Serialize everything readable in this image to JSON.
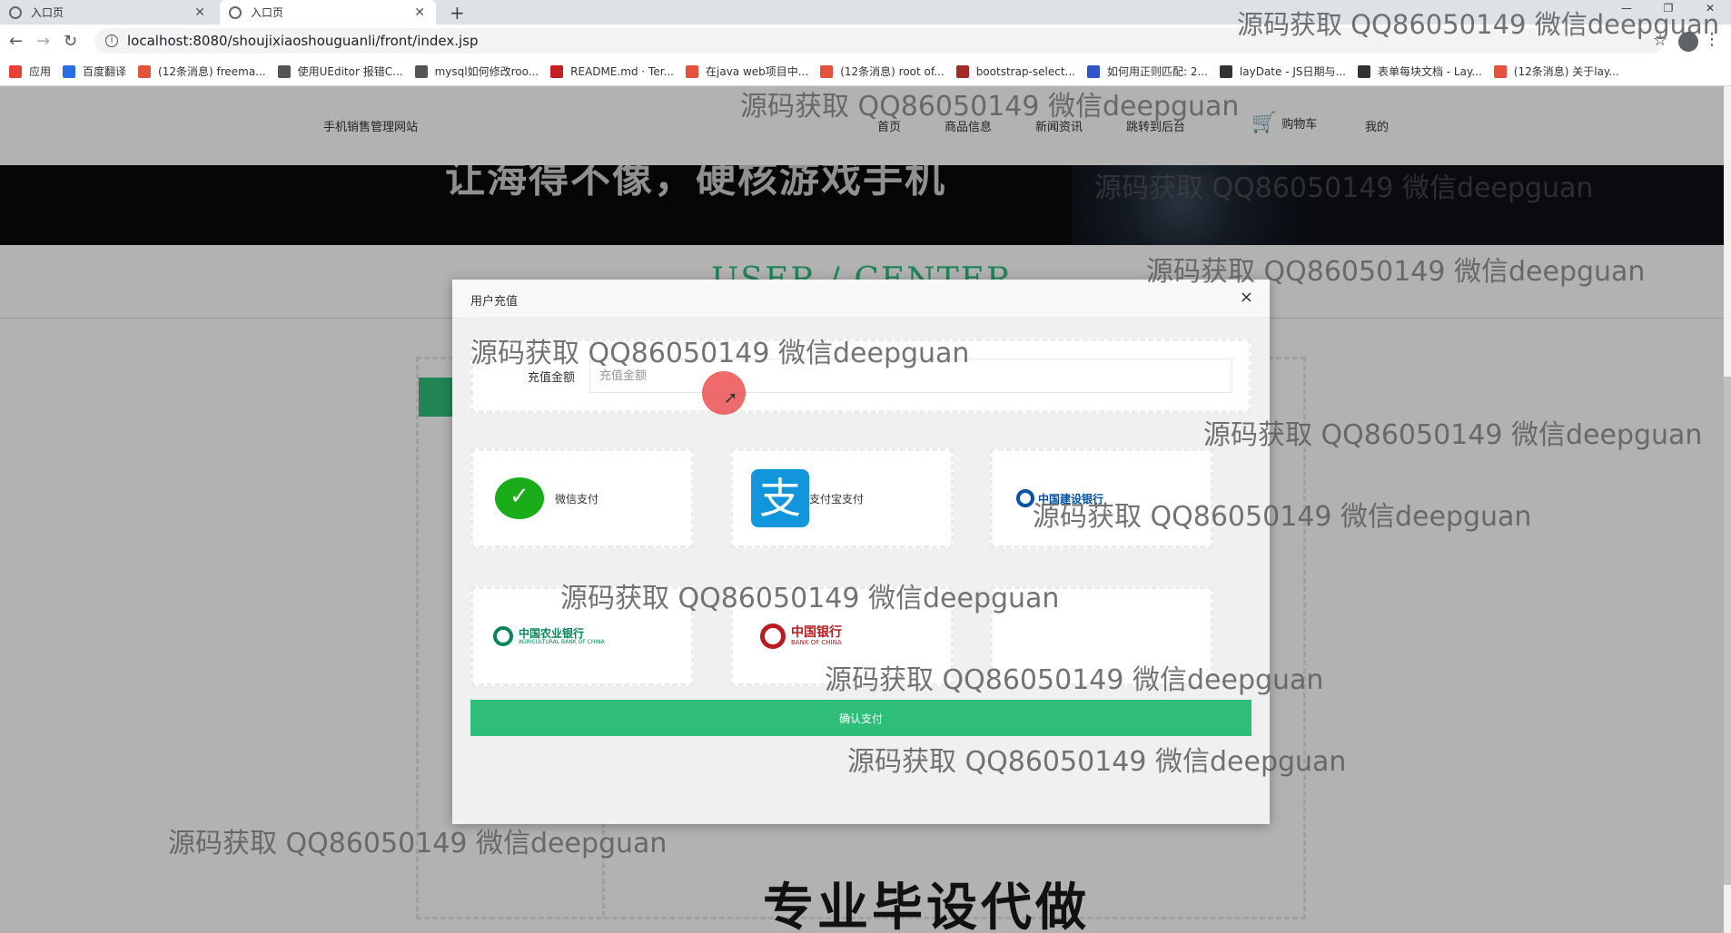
{
  "browser": {
    "tabs": [
      {
        "label": "入口页",
        "active": false
      },
      {
        "label": "入口页",
        "active": true
      }
    ],
    "new_tab": "+",
    "url": "localhost:8080/shoujixiaoshouguanli/front/index.jsp",
    "bookmarks": [
      {
        "label": "应用",
        "color": "#e94235"
      },
      {
        "label": "百度翻译",
        "color": "#2b6de5"
      },
      {
        "label": "(12条消息) freema...",
        "color": "#e4523d"
      },
      {
        "label": "使用UEditor 报错C...",
        "color": "#555555"
      },
      {
        "label": "mysql如何修改roo...",
        "color": "#555555"
      },
      {
        "label": "README.md · Ter...",
        "color": "#c71d23"
      },
      {
        "label": "在java web项目中...",
        "color": "#e4523d"
      },
      {
        "label": "(12条消息) root of...",
        "color": "#e4523d"
      },
      {
        "label": "bootstrap-select...",
        "color": "#a52a2a"
      },
      {
        "label": "如何用正则匹配: 2...",
        "color": "#3253c9"
      },
      {
        "label": "layDate - JS日期与...",
        "color": "#333333"
      },
      {
        "label": "表单每块文档 - Lay...",
        "color": "#333333"
      },
      {
        "label": "(12条消息) 关于lay...",
        "color": "#e4523d"
      }
    ]
  },
  "site": {
    "title": "手机销售管理网站",
    "nav": [
      "首页",
      "商品信息",
      "新闻资讯",
      "跳转到后台"
    ],
    "cart": "购物车",
    "mine": "我的",
    "banner_text": "让海得不像，硬核游戏手机",
    "section_title": "USER / CENTER"
  },
  "modal": {
    "title": "用户充值",
    "close": "×",
    "amount_label": "充值金额",
    "amount_placeholder": "充值金额",
    "amount_value": "",
    "payment_options": [
      {
        "label": "微信支付",
        "icon": "wechat-pay-icon"
      },
      {
        "label": "支付宝支付",
        "icon": "alipay-icon"
      },
      {
        "label": "中国建设银行",
        "icon": "ccb-logo"
      },
      {
        "label": "中国农业银行",
        "icon": "abc-logo"
      },
      {
        "label": "中国银行",
        "icon": "boc-logo"
      }
    ],
    "abc_sub": "AGRICULTURAL BANK OF CHINA",
    "boc_sub": "BANK OF CHINA",
    "confirm": "确认支付"
  },
  "watermark": "源码获取 QQ86050149 微信deepguan",
  "bottom_promo": "专业毕设代做",
  "colors": {
    "accent": "#2fbe7a",
    "wechat": "#1aad19",
    "alipay": "#1296db",
    "ccb": "#0052a4",
    "abc": "#00865a",
    "boc": "#b81c22"
  }
}
